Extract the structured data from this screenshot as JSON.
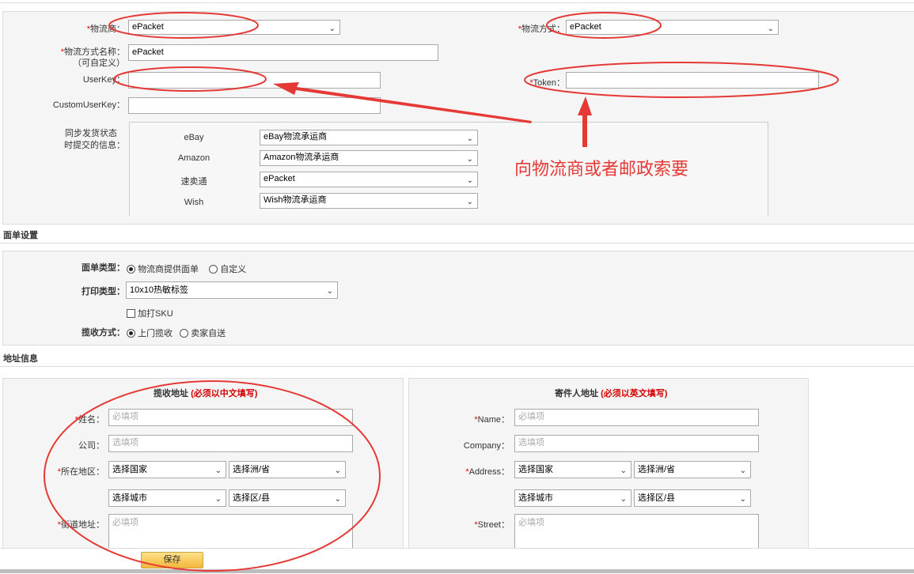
{
  "logistics": {
    "carrier_label": "物流商：",
    "carrier_value": "ePacket",
    "method_label": "物流方式：",
    "method_value": "ePacket",
    "method_name_label_1": "物流方式名称：",
    "method_name_label_2": "（可自定义）",
    "method_name_value": "ePacket",
    "userkey_label": "UserKey：",
    "token_label": "Token：",
    "customuserkey_label": "CustomUserKey：",
    "sync_label_1": "同步发货状态",
    "sync_label_2": "时提交的信息：",
    "sync_rows": [
      {
        "platform": "eBay",
        "value": "eBay物流承运商"
      },
      {
        "platform": "Amazon",
        "value": "Amazon物流承运商"
      },
      {
        "platform": "速卖通",
        "value": "ePacket"
      },
      {
        "platform": "Wish",
        "value": "Wish物流承运商"
      }
    ]
  },
  "annotation": {
    "text": "向物流商或者邮政索要",
    "color": "#e53935"
  },
  "label_settings": {
    "section_title": "面单设置",
    "type_label": "面单类型：",
    "type_options": [
      "物流商提供面单",
      "自定义"
    ],
    "print_label": "打印类型：",
    "print_value": "10x10热敏标签",
    "sku_label": "加打SKU",
    "pickup_label": "揽收方式：",
    "pickup_options": [
      "上门揽收",
      "卖家自送"
    ]
  },
  "address": {
    "section_title": "地址信息",
    "pickup": {
      "title": "揽收地址",
      "title_note": "(必须以中文填写)",
      "name_label": "姓名：",
      "name_ph": "必填项",
      "company_label": "公司：",
      "company_ph": "选填项",
      "region_label": "所在地区：",
      "country": "选择国家",
      "province": "选择洲/省",
      "city": "选择城市",
      "district": "选择区/县",
      "street_label": "街道地址：",
      "street_ph": "必填项"
    },
    "sender": {
      "title": "寄件人地址",
      "title_note": "(必须以英文填写)",
      "name_label": "Name：",
      "name_ph": "必填项",
      "company_label": "Company：",
      "company_ph": "选填项",
      "region_label": "Address：",
      "country": "选择国家",
      "province": "选择洲/省",
      "city": "选择城市",
      "district": "选择区/县",
      "street_label": "Street：",
      "street_ph": "必填项"
    }
  },
  "save_label": "保存"
}
